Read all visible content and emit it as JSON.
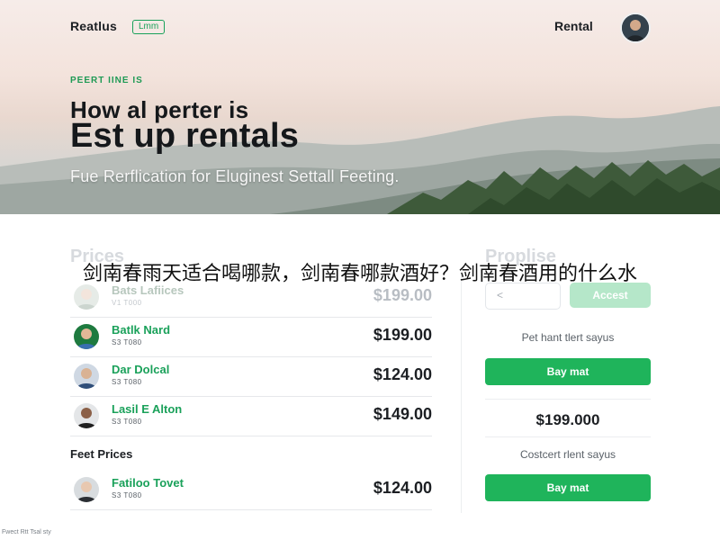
{
  "header": {
    "brand": "Reatlus",
    "badge": "Lmm",
    "nav_link": "Rental"
  },
  "hero": {
    "eyebrow": "PEERT IINE IS",
    "heading_line1": "How al perter is",
    "heading_line2": "Est up rentals",
    "subheading": "Fue Rerflication for Eluginest Settall Feeting."
  },
  "overlay_caption": "剑南春雨天适合喝哪款，剑南春哪款酒好？剑南春酒用的什么水",
  "prices": {
    "title": "Prices",
    "rows": [
      {
        "name": "Bats Lafiices",
        "meta": "V1 T000",
        "price": "$199.00",
        "muted": true
      },
      {
        "name": "Batlk Nard",
        "meta": "S3 T080",
        "price": "$199.00",
        "muted": false
      },
      {
        "name": "Dar Dolcal",
        "meta": "S3 T080",
        "price": "$124.00",
        "muted": false
      },
      {
        "name": "Lasil E Alton",
        "meta": "S3 T080",
        "price": "$149.00",
        "muted": false
      }
    ],
    "sub_title": "Feet Prices",
    "feature_row": {
      "name": "Fatiloo Tovet",
      "meta": "S3 T080",
      "price": "$124.00"
    }
  },
  "panel": {
    "title": "Proplise",
    "back_label": "<",
    "accent_label": "Accest",
    "label_1": "Pet hant tlert sayus",
    "button_1": "Bay mat",
    "price": "$199.000",
    "label_2": "Costcert rlent sayus",
    "button_2": "Bay mat"
  },
  "footer": {
    "text": "Fwect Rtt Tsal sty"
  },
  "colors": {
    "accent": "#1fb45b",
    "accent_light": "#b5e7c9",
    "text": "#1c1f23"
  }
}
